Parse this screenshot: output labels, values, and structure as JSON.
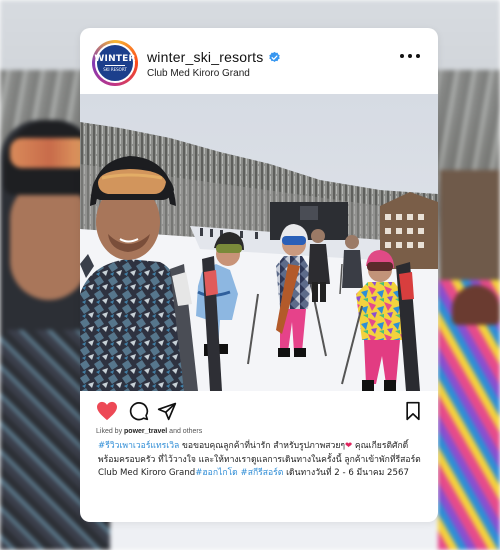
{
  "post": {
    "username": "winter_ski_resorts",
    "location": "Club Med Kiroro Grand",
    "verified": true,
    "avatar": {
      "logo_main": "WINTER",
      "logo_sub": "SKI RESORT"
    },
    "liked_by_prefix": "Liked by",
    "liked_by_user": "power_travel",
    "liked_by_suffix": "and others",
    "caption": {
      "hashtag_1": "#รีวิวเพาเวอร์แทรเวิล",
      "text_1": " ขอขอบคุณลูกค้าที่น่ารัก สำหรับรูปภาพสวยๆ",
      "heart": "❤",
      "text_2": " คุณเกียรติศักดิ์ พร้อมครอบครัว ที่ไว้วางใจ และให้ทางเราดูแลการเดินทางในครั้งนี้ ลูกค้าเข้าพักที่รีสอร์ต Club Med Kiroro Grand",
      "hashtag_2": "#ฮอกไกโด",
      "space": " ",
      "hashtag_3": "#สกีรีสอร์ต",
      "text_3": " เดินทางวันที่ 2 - 6 มีนาคม 2567"
    }
  },
  "icons": {
    "like": "heart-icon",
    "comment": "comment-icon",
    "share": "share-icon",
    "save": "bookmark-icon",
    "more": "more-options-icon",
    "verified": "verified-badge-icon"
  },
  "colors": {
    "like_red": "#ed4956",
    "hashtag_blue": "#2f8dd6",
    "verified_blue": "#3897f0",
    "avatar_navy": "#1c3f8c"
  }
}
